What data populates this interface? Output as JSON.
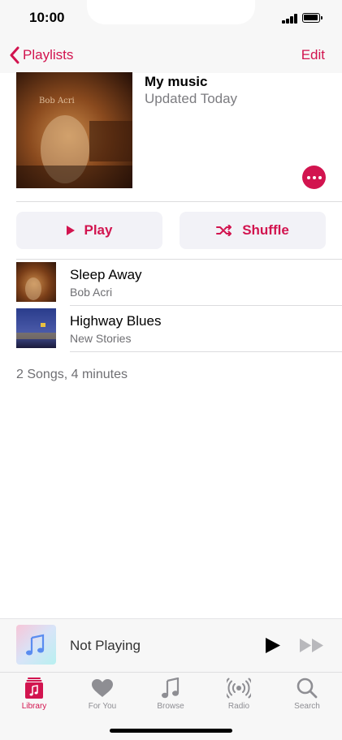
{
  "status": {
    "time": "10:00"
  },
  "nav": {
    "back_label": "Playlists",
    "edit_label": "Edit"
  },
  "playlist": {
    "title": "My music",
    "subtitle": "Updated Today",
    "play_label": "Play",
    "shuffle_label": "Shuffle",
    "summary": "2 Songs, 4 minutes"
  },
  "tracks": [
    {
      "title": "Sleep Away",
      "artist": "Bob Acri"
    },
    {
      "title": "Highway Blues",
      "artist": "New Stories"
    }
  ],
  "mini_player": {
    "title": "Not Playing"
  },
  "tabs": [
    {
      "label": "Library",
      "icon": "library-icon",
      "active": true
    },
    {
      "label": "For You",
      "icon": "heart-icon",
      "active": false
    },
    {
      "label": "Browse",
      "icon": "music-note-icon",
      "active": false
    },
    {
      "label": "Radio",
      "icon": "radio-icon",
      "active": false
    },
    {
      "label": "Search",
      "icon": "search-icon",
      "active": false
    }
  ],
  "colors": {
    "accent": "#d2144f",
    "bar_background": "#f7f7f7",
    "secondary_text": "#7c7c80"
  }
}
